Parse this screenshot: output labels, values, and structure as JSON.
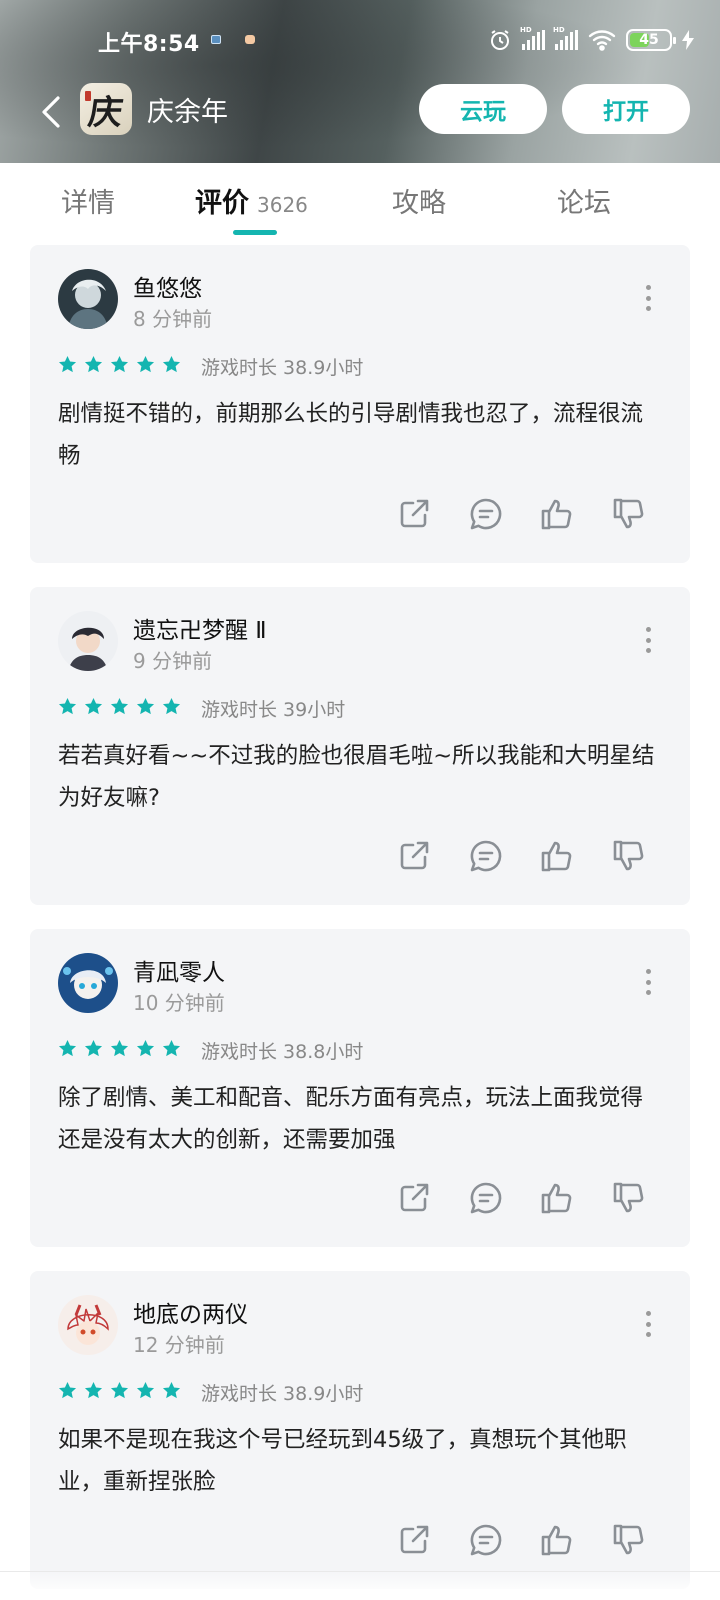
{
  "status_bar": {
    "time": "上午8:54",
    "battery": "45"
  },
  "app": {
    "title": "庆余年",
    "logo_text": "庆"
  },
  "buttons": {
    "cloud_play": "云玩",
    "open": "打开"
  },
  "tabs": [
    {
      "label": "详情"
    },
    {
      "label": "评价",
      "count": "3626"
    },
    {
      "label": "攻略"
    },
    {
      "label": "论坛"
    }
  ],
  "colors": {
    "accent": "#14b5b0",
    "card_bg": "#f4f5f7"
  },
  "reviews": [
    {
      "user": "鱼悠悠",
      "time": "8 分钟前",
      "rating": 5,
      "playtime": "游戏时长 38.9小时",
      "text": "剧情挺不错的，前期那么长的引导剧情我也忍了，流程很流畅"
    },
    {
      "user": "遗忘卍梦醒 Ⅱ",
      "time": "9 分钟前",
      "rating": 5,
      "playtime": "游戏时长 39小时",
      "text": "若若真好看~~不过我的脸也很眉毛啦~所以我能和大明星结为好友嘛?"
    },
    {
      "user": "青凪零人",
      "time": "10 分钟前",
      "rating": 5,
      "playtime": "游戏时长 38.8小时",
      "text": "除了剧情、美工和配音、配乐方面有亮点，玩法上面我觉得还是没有太大的创新，还需要加强"
    },
    {
      "user": "地底の两仪",
      "time": "12 分钟前",
      "rating": 5,
      "playtime": "游戏时长 38.9小时",
      "text": "如果不是现在我这个号已经玩到45级了，真想玩个其他职业，重新捏张脸"
    }
  ]
}
